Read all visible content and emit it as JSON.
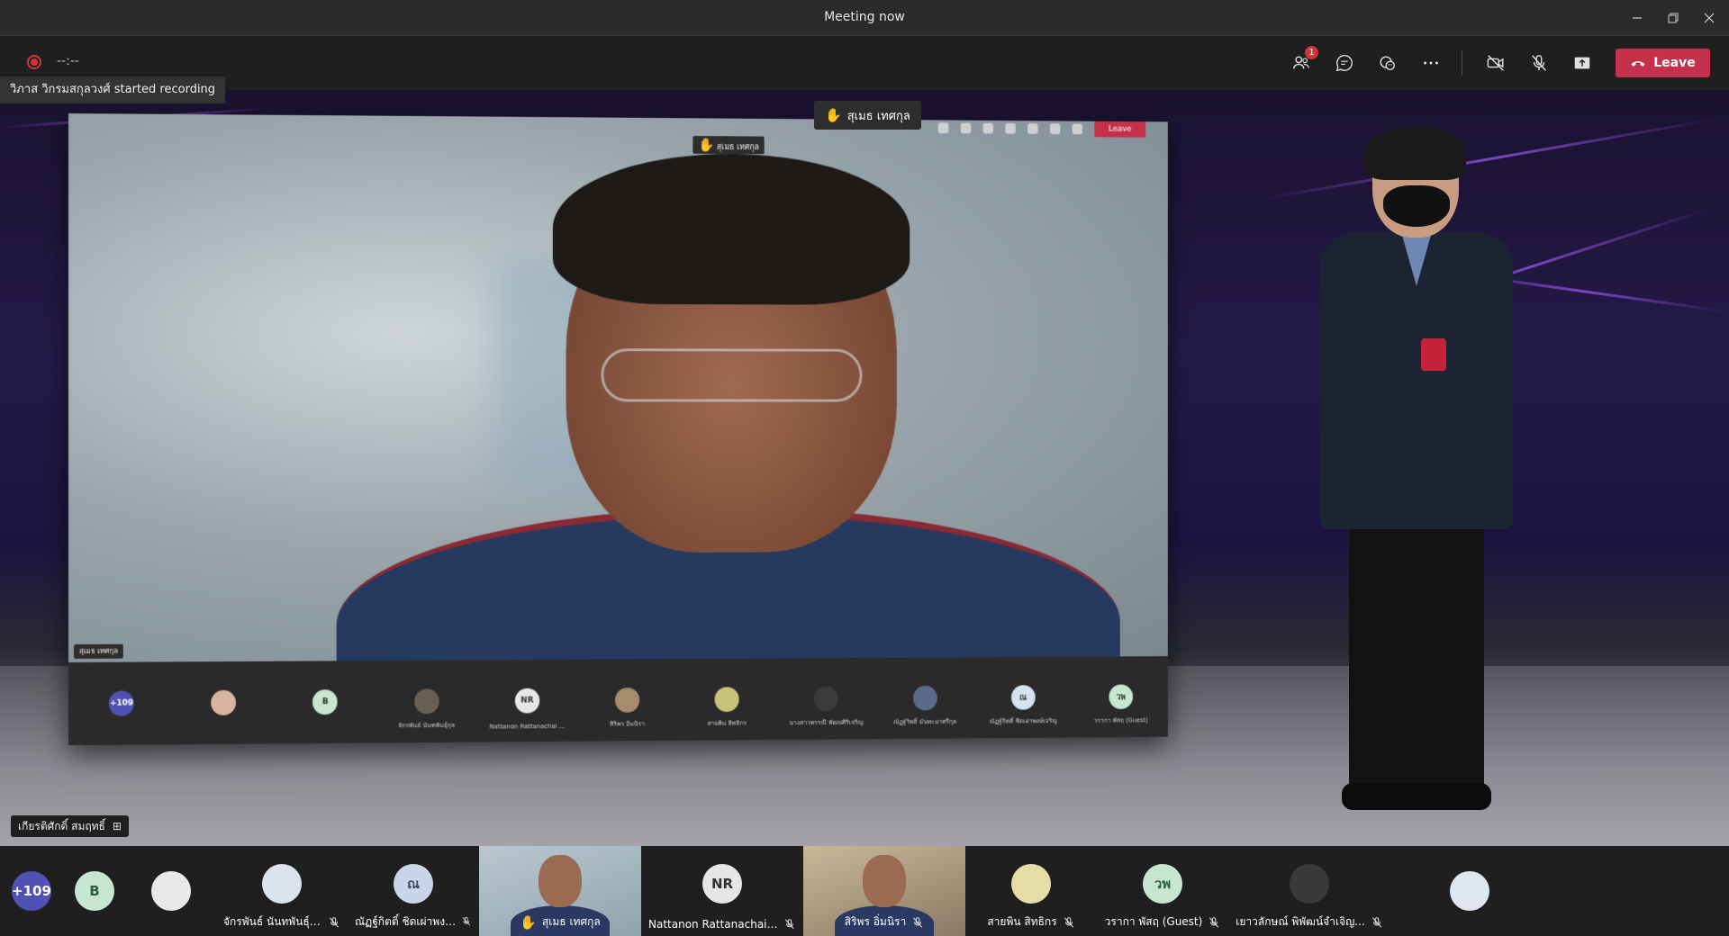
{
  "window": {
    "title": "Meeting now"
  },
  "toolbar": {
    "timer": "--:--",
    "participants_badge": "1",
    "leave_label": "Leave"
  },
  "toast": {
    "text": "วิภาส วิกรมสกุลวงศ์ started recording"
  },
  "stage": {
    "raise_hand_name": "สุเมธ เทศกุล",
    "pinned_name": "เกียรติศักดิ์ สมฤทธิ์"
  },
  "shared_screen": {
    "leave_label": "Leave",
    "chip_name": "สุเมธ เทศกุล",
    "speaker_label": "สุเมธ เทศกุล",
    "overflow_count": "+109",
    "tiles": [
      {
        "initials": "+109",
        "name": "",
        "bg": "#4f52b2"
      },
      {
        "initials": "",
        "name": "",
        "bg": "#d9b4a0"
      },
      {
        "initials": "B",
        "name": "",
        "bg": "#c6e6d2"
      },
      {
        "initials": "",
        "name": "จักรพันธ์ นันทพันธุ์กุล",
        "bg": "#6a5f54"
      },
      {
        "initials": "NR",
        "name": "Nattanon Rattanachai ...",
        "bg": "#e6e6e6"
      },
      {
        "initials": "",
        "name": "สิริพร อิ่มนิรา",
        "bg": "#a88a6c"
      },
      {
        "initials": "",
        "name": "สายพิน สิทธิกร",
        "bg": "#c8c27a"
      },
      {
        "initials": "",
        "name": "นางสาวพรรณี พัฒนศิริเจริญ",
        "bg": "#3b3b3b"
      },
      {
        "initials": "",
        "name": "ณัฏฐ์วิทธิ์ มันทะนาศรีกุล",
        "bg": "#5c6a8a"
      },
      {
        "initials": "ณ",
        "name": "ณัฏฐ์กิตติ์ ชิดเผ่าพงษ์เจริญ",
        "bg": "#d7e2f0"
      },
      {
        "initials": "วพ",
        "name": "วรากา พัสฤ (Guest)",
        "bg": "#c6e6d2"
      }
    ]
  },
  "bottom_strip": [
    {
      "initials": "+109",
      "name": "",
      "bg": "#4f52b2",
      "fg": "#ffffff",
      "type": "avatar"
    },
    {
      "initials": "B",
      "name": "",
      "bg": "#c6e6d2",
      "fg": "#2b5d3f",
      "type": "avatar"
    },
    {
      "initials": "",
      "name": "",
      "bg": "#e8e8e8",
      "fg": "#333",
      "type": "photo"
    },
    {
      "initials": "",
      "name": "จักรพันธ์ นันทพันธุ์กุล",
      "bg": "#dde3ec",
      "fg": "#333",
      "type": "photo"
    },
    {
      "initials": "ณ",
      "name": "ณัฏฐ์กิตติ์ ชิดเผ่าพงษ์เจริญ",
      "bg": "#c9d6ea",
      "fg": "#3a4b6a",
      "type": "avatar"
    },
    {
      "initials": "",
      "name": "สุเมธ เทศกุล",
      "bg": "",
      "fg": "",
      "type": "video"
    },
    {
      "initials": "NR",
      "name": "Nattanon Rattanachai ...",
      "bg": "#e6e6e6",
      "fg": "#333333",
      "type": "avatar"
    },
    {
      "initials": "",
      "name": "สิริพร อิ่มนิรา",
      "bg": "",
      "fg": "",
      "type": "video-room"
    },
    {
      "initials": "",
      "name": "สายพิน สิทธิกร",
      "bg": "#e5dca8",
      "fg": "#333",
      "type": "photo"
    },
    {
      "initials": "วพ",
      "name": "วรากา พัสฤ (Guest)",
      "bg": "#c6e6d2",
      "fg": "#2b5d3f",
      "type": "avatar"
    },
    {
      "initials": "",
      "name": "เยาวลักษณ์ พิพัฒน์จำเจิญ...",
      "bg": "#3a3a3a",
      "fg": "#fff",
      "type": "photo"
    },
    {
      "initials": "",
      "name": "",
      "bg": "#dfe6ee",
      "fg": "#333",
      "type": "photo"
    }
  ],
  "colors": {
    "leave": "#c4314b",
    "accent": "#4f52b2",
    "raise_hand": "#ffc83d",
    "recording": "#d13438"
  },
  "icons": [
    "record-icon",
    "participants-icon",
    "chat-icon",
    "reactions-icon",
    "more-icon",
    "camera-off-icon",
    "mic-off-icon",
    "share-icon",
    "phone-hangup-icon",
    "raise-hand-icon",
    "pin-icon"
  ]
}
